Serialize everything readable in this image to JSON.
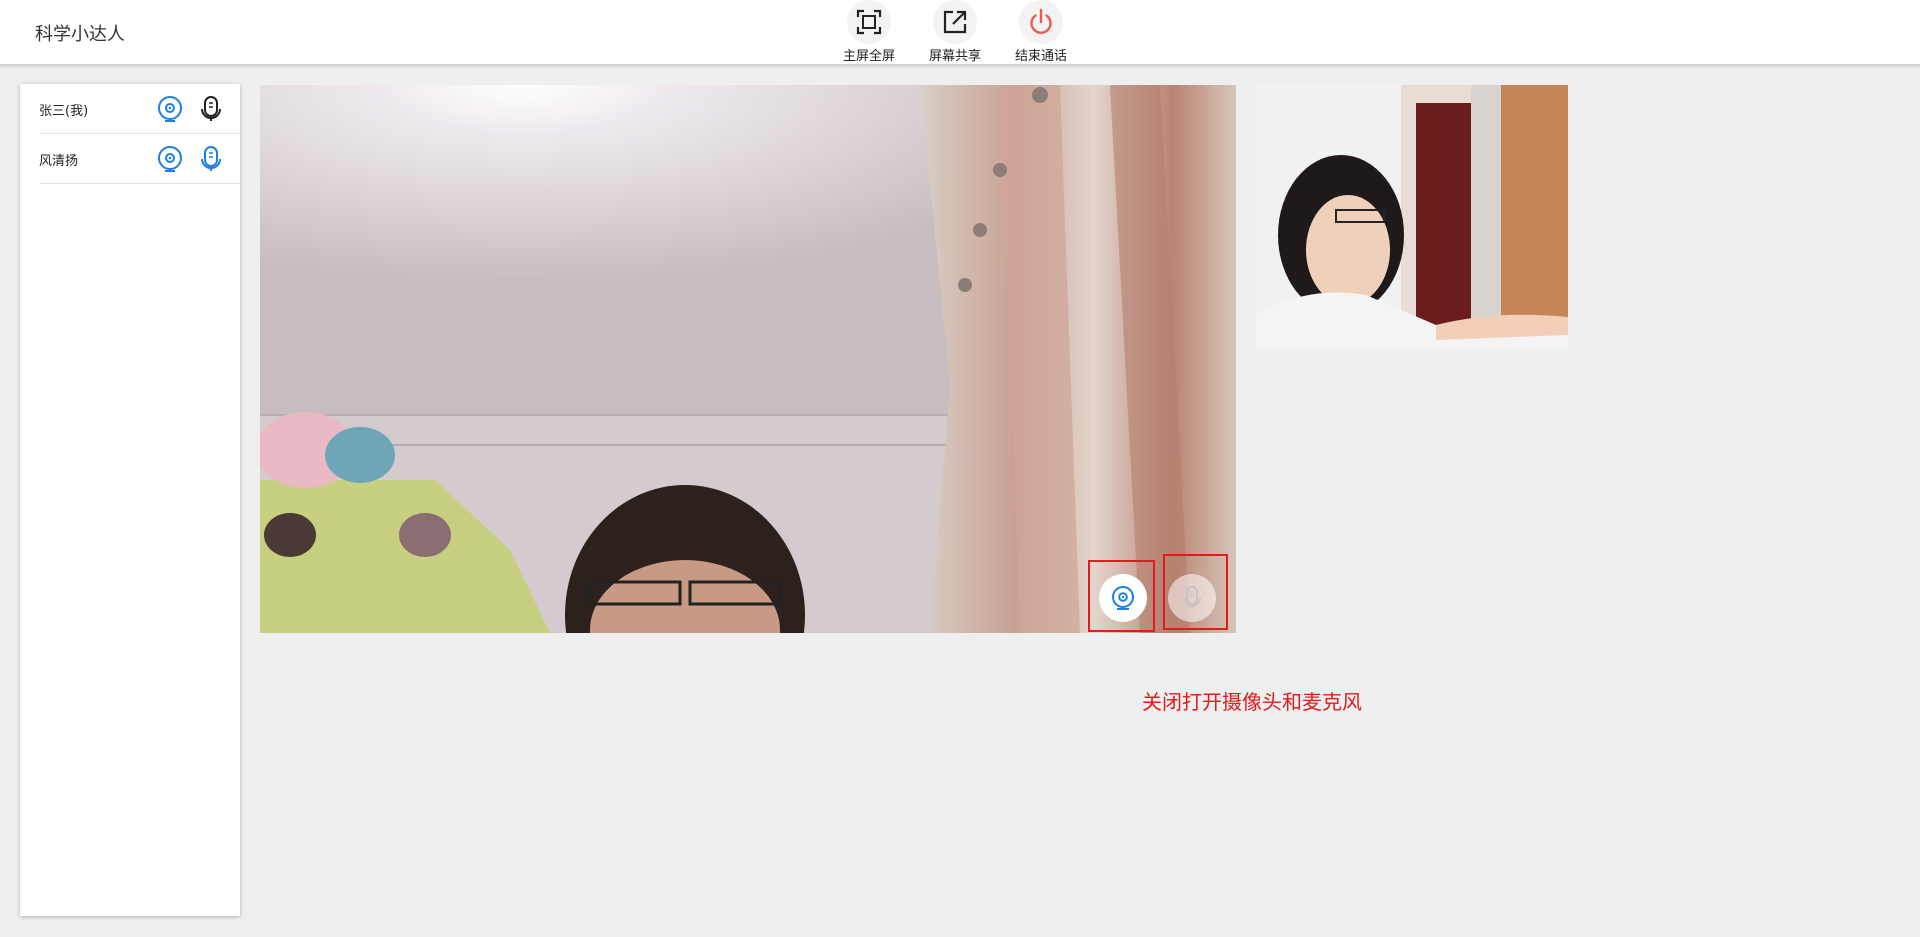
{
  "app": {
    "title": "科学小达人"
  },
  "toolbar": [
    {
      "label": "主屏全屏",
      "icon": "fullscreen-icon"
    },
    {
      "label": "屏幕共享",
      "icon": "screen-share-icon"
    },
    {
      "label": "结束通话",
      "icon": "power-icon"
    }
  ],
  "members": [
    {
      "name": "张三(我)",
      "camera": "on",
      "mic": "on"
    },
    {
      "name": "风清扬",
      "camera": "on",
      "mic": "on"
    }
  ],
  "main_controls": {
    "camera_icon": "camera-icon",
    "mic_icon": "mic-icon"
  },
  "annotation": "关闭打开摄像头和麦克风",
  "colors": {
    "accent_blue": "#1f7fe0",
    "end_call_red": "#ef5a4f",
    "annotation_red": "#e21b1b"
  }
}
